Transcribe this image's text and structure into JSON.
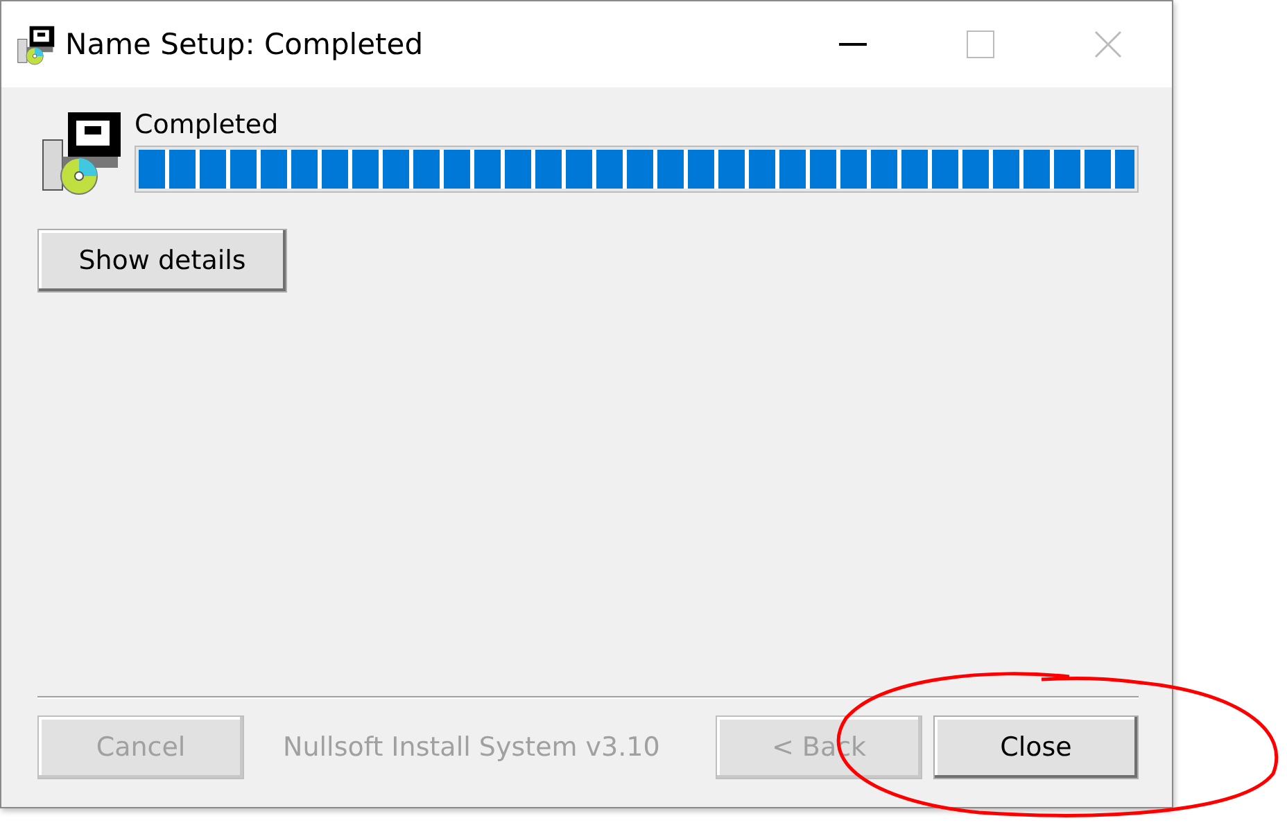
{
  "window": {
    "title": "Name Setup: Completed"
  },
  "status": {
    "label": "Completed",
    "level": 1
  },
  "details_button": {
    "label": "Show details"
  },
  "footer": {
    "branding": "Nullsoft Install System v3.10",
    "buttons": [
      {
        "label": "Cancel",
        "disabled": true
      },
      {
        "label": "< Back",
        "disabled": true
      },
      {
        "label": "Close",
        "disabled": false
      }
    ]
  },
  "annotation": {
    "kind": "circle"
  }
}
